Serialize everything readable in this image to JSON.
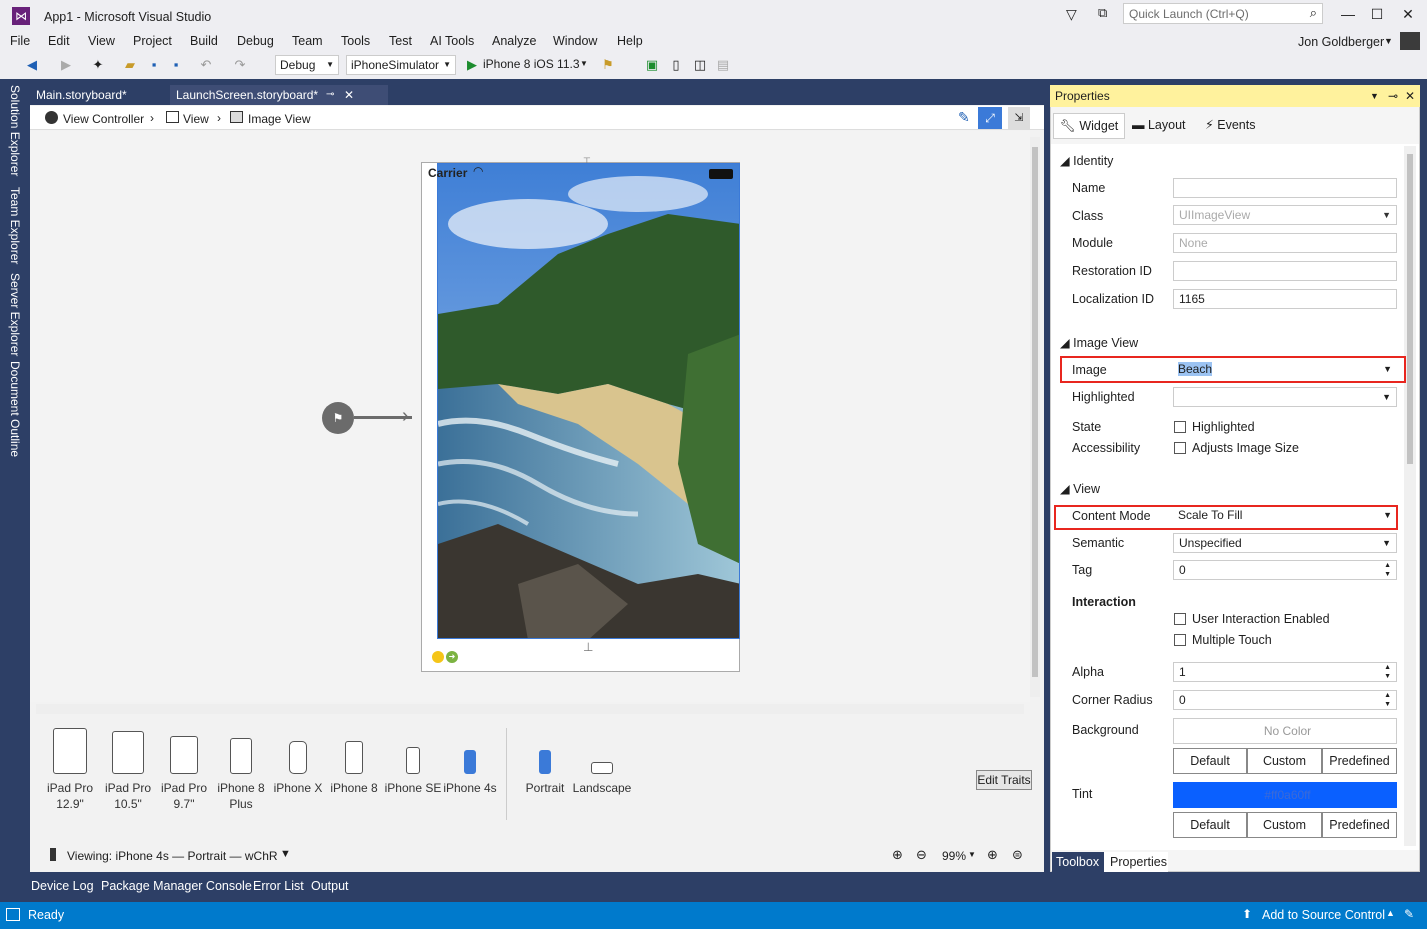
{
  "window": {
    "title": "App1 - Microsoft Visual Studio",
    "quick_launch_placeholder": "Quick Launch (Ctrl+Q)",
    "user": "Jon Goldberger"
  },
  "menu": [
    "File",
    "Edit",
    "View",
    "Project",
    "Build",
    "Debug",
    "Team",
    "Tools",
    "Test",
    "AI Tools",
    "Analyze",
    "Window",
    "Help"
  ],
  "toolbar": {
    "config": "Debug",
    "platform": "iPhoneSimulator",
    "run_target": "iPhone 8 iOS 11.3"
  },
  "side_tabs": [
    "Solution Explorer",
    "Team Explorer",
    "Server Explorer",
    "Document Outline"
  ],
  "doc_tabs": [
    {
      "label": "Main.storyboard*"
    },
    {
      "label": "LaunchScreen.storyboard*"
    }
  ],
  "breadcrumb": [
    "View Controller",
    "View",
    "Image View"
  ],
  "phone": {
    "carrier": "Carrier"
  },
  "devices": [
    {
      "label": "iPad Pro",
      "sub": "12.9\""
    },
    {
      "label": "iPad Pro",
      "sub": "10.5\""
    },
    {
      "label": "iPad Pro",
      "sub": "9.7\""
    },
    {
      "label": "iPhone 8",
      "sub": "Plus"
    },
    {
      "label": "iPhone X",
      "sub": ""
    },
    {
      "label": "iPhone 8",
      "sub": ""
    },
    {
      "label": "iPhone SE",
      "sub": ""
    },
    {
      "label": "iPhone 4s",
      "sub": ""
    }
  ],
  "orientations": [
    "Portrait",
    "Landscape"
  ],
  "edit_traits": "Edit Traits",
  "viewing": "Viewing: iPhone 4s — Portrait — wChR",
  "zoom": "99%",
  "properties": {
    "title": "Properties",
    "tabs": [
      "Widget",
      "Layout",
      "Events"
    ],
    "identity": {
      "section": "Identity",
      "name_label": "Name",
      "name_value": "",
      "class_label": "Class",
      "class_value": "UIImageView",
      "module_label": "Module",
      "module_value": "None",
      "restoration_label": "Restoration ID",
      "restoration_value": "",
      "localization_label": "Localization ID",
      "localization_value": "1165"
    },
    "image_view": {
      "section": "Image View",
      "image_label": "Image",
      "image_value": "Beach",
      "highlighted_label": "Highlighted",
      "highlighted_value": "",
      "state_label": "State",
      "state_check": "Highlighted",
      "accessibility_label": "Accessibility",
      "accessibility_check": "Adjusts Image Size"
    },
    "view": {
      "section": "View",
      "content_mode_label": "Content Mode",
      "content_mode_value": "Scale To Fill",
      "semantic_label": "Semantic",
      "semantic_value": "Unspecified",
      "tag_label": "Tag",
      "tag_value": "0",
      "interaction_label": "Interaction",
      "user_interaction": "User Interaction Enabled",
      "multiple_touch": "Multiple Touch",
      "alpha_label": "Alpha",
      "alpha_value": "1",
      "corner_label": "Corner Radius",
      "corner_value": "0",
      "background_label": "Background",
      "background_value": "No Color",
      "tint_label": "Tint",
      "tint_value": "#ff0a60ff",
      "tint_color": "#0a60ff",
      "btn_default": "Default",
      "btn_custom": "Custom",
      "btn_predefined": "Predefined"
    },
    "bottom_tabs": [
      "Toolbox",
      "Properties"
    ]
  },
  "bottom_tabs": [
    "Device Log",
    "Package Manager Console",
    "Error List",
    "Output"
  ],
  "status": {
    "ready": "Ready",
    "source_control": "Add to Source Control"
  }
}
